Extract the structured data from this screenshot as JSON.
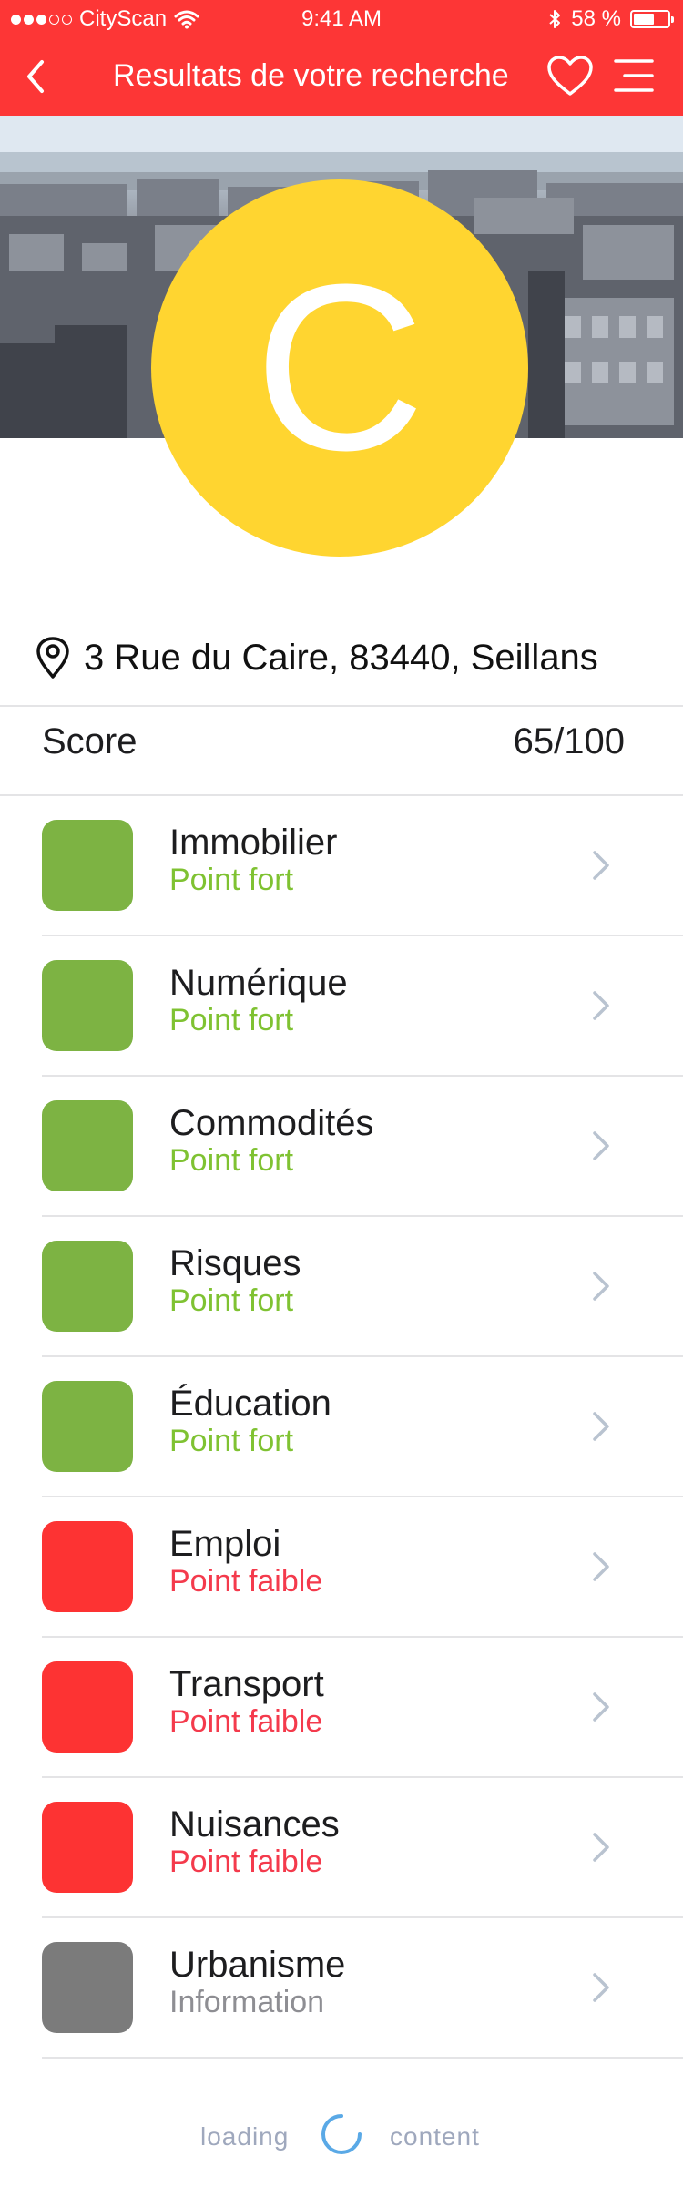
{
  "status_bar": {
    "carrier": "CityScan",
    "time": "9:41 AM",
    "battery": "58 %"
  },
  "nav": {
    "title": "Resultats de votre recherche",
    "back_icon": "chevron-left-icon",
    "favorite_icon": "heart-icon",
    "menu_icon": "menu-icon"
  },
  "grade": {
    "letter": "C",
    "color": "#ffd530"
  },
  "address": {
    "text": "3 Rue du Caire, 83440, Seillans",
    "icon": "location-pin-icon"
  },
  "score": {
    "label": "Score",
    "value": "65/100"
  },
  "categories": [
    {
      "name": "Immobilier",
      "status": "Point fort",
      "color": "#7db343",
      "status_color": "#7fc232"
    },
    {
      "name": "Numérique",
      "status": "Point fort",
      "color": "#7db343",
      "status_color": "#7fc232"
    },
    {
      "name": "Commodités",
      "status": "Point fort",
      "color": "#7db343",
      "status_color": "#7fc232"
    },
    {
      "name": "Risques",
      "status": "Point fort",
      "color": "#7db343",
      "status_color": "#7fc232"
    },
    {
      "name": "Éducation",
      "status": "Point fort",
      "color": "#7db343",
      "status_color": "#7fc232"
    },
    {
      "name": "Emploi",
      "status": "Point faible",
      "color": "#fd3333",
      "status_color": "#f43a4c"
    },
    {
      "name": "Transport",
      "status": "Point faible",
      "color": "#fd3333",
      "status_color": "#f43a4c"
    },
    {
      "name": "Nuisances",
      "status": "Point faible",
      "color": "#fd3333",
      "status_color": "#f43a4c"
    },
    {
      "name": "Urbanisme",
      "status": "Information",
      "color": "#7b7b7b",
      "status_color": "#8e8e93"
    }
  ],
  "loading": {
    "left": "loading",
    "right": "content"
  },
  "colors": {
    "brand_red": "#fd3636",
    "chevron": "#b9c3d0",
    "separator": "#e4e4e6"
  }
}
